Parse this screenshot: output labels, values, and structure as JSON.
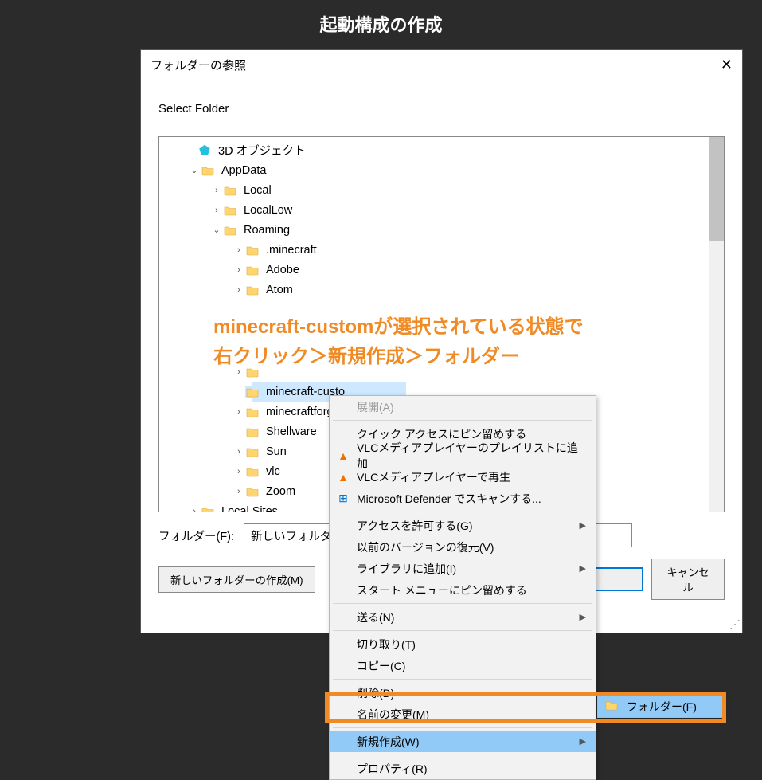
{
  "page": {
    "title": "起動構成の作成"
  },
  "dialog": {
    "title": "フォルダーの参照",
    "subtitle": "Select Folder",
    "folder_label": "フォルダー(F):",
    "folder_value": "新しいフォルダー",
    "new_folder_btn": "新しいフォルダーの作成(M)",
    "cancel_btn": "キャンセル"
  },
  "tree": {
    "objects3d": "3D オブジェクト",
    "appdata": "AppData",
    "local": "Local",
    "locallow": "LocalLow",
    "roaming": "Roaming",
    "minecraft": ".minecraft",
    "adobe": "Adobe",
    "atom": "Atom",
    "mc_custom": "minecraft-custo",
    "mc_forge": "minecraftforge",
    "shellware": "Shellware",
    "sun": "Sun",
    "vlc": "vlc",
    "zoom": "Zoom",
    "localsites": "Local Sites"
  },
  "annotation": {
    "line1": "minecraft-customが選択されている状態で",
    "line2": "右クリック＞新規作成＞フォルダー"
  },
  "ctx": {
    "expand": "展開(A)",
    "pin_quick": "クイック アクセスにピン留めする",
    "vlc_playlist": "VLCメディアプレイヤーのプレイリストに追加",
    "vlc_play": "VLCメディアプレイヤーで再生",
    "defender": "Microsoft Defender でスキャンする...",
    "access": "アクセスを許可する(G)",
    "prev_ver": "以前のバージョンの復元(V)",
    "library": "ライブラリに追加(I)",
    "pin_start": "スタート メニューにピン留めする",
    "send": "送る(N)",
    "cut": "切り取り(T)",
    "copy": "コピー(C)",
    "delete": "削除(D)",
    "rename": "名前の変更(M)",
    "new": "新規作成(W)",
    "properties": "プロパティ(R)"
  },
  "submenu": {
    "folder": "フォルダー(F)"
  }
}
